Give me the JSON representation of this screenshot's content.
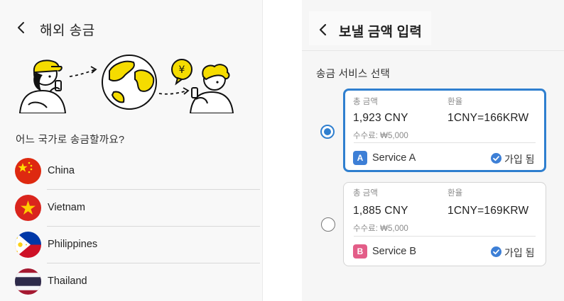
{
  "left": {
    "title": "해외 송금",
    "question": "어느 국가로 송금할까요?",
    "countries": [
      {
        "name": "China",
        "flag": "china-flag-icon"
      },
      {
        "name": "Vietnam",
        "flag": "vietnam-flag-icon"
      },
      {
        "name": "Philippines",
        "flag": "philippines-flag-icon"
      },
      {
        "name": "Thailand",
        "flag": "thailand-flag-icon"
      }
    ],
    "illustration": {
      "currency_symbol": "¥"
    }
  },
  "right": {
    "title": "보낼 금액 입력",
    "section_label": "송금 서비스 선택",
    "services": [
      {
        "selected": true,
        "amount_label": "총 금액",
        "amount": "1,923 CNY",
        "rate_label": "환율",
        "rate": "1CNY=166KRW",
        "fee": "수수료: ₩5,000",
        "badge": "A",
        "badge_color": "#3d7fd6",
        "name": "Service A",
        "status": "가입 됨"
      },
      {
        "selected": false,
        "amount_label": "총 금액",
        "amount": "1,885 CNY",
        "rate_label": "환율",
        "rate": "1CNY=169KRW",
        "fee": "수수료: ₩5,000",
        "badge": "B",
        "badge_color": "#e35d88",
        "name": "Service B",
        "status": "가입 됨"
      }
    ]
  },
  "colors": {
    "accent": "#2f7fcf",
    "illustration_yellow": "#f5dc00",
    "check_blue": "#3d7fd6"
  }
}
